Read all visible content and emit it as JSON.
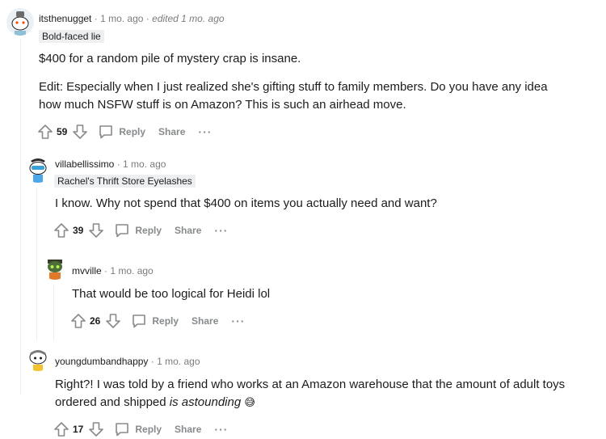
{
  "comments": [
    {
      "username": "itsthenugget",
      "sep": "·",
      "time": "1 mo. ago",
      "edited": "edited 1 mo. ago",
      "flair": "Bold-faced lie",
      "paragraphs": [
        "$400 for a random pile of mystery crap is insane.",
        "Edit: Especially when I just realized she's gifting stuff to family members. Do you have any idea how much NSFW stuff is on Amazon? This is such an airhead move."
      ],
      "score": "59",
      "reply": "Reply",
      "share": "Share",
      "more": "···"
    },
    {
      "username": "villabellissimo",
      "sep": "·",
      "time": "1 mo. ago",
      "flair": "Rachel's Thrift Store Eyelashes",
      "text": "I know. Why not spend that $400 on items you actually need and want?",
      "score": "39",
      "reply": "Reply",
      "share": "Share",
      "more": "···"
    },
    {
      "username": "mvville",
      "sep": "·",
      "time": "1 mo. ago",
      "text": "That would be too logical for Heidi lol",
      "score": "26",
      "reply": "Reply",
      "share": "Share",
      "more": "···"
    },
    {
      "username": "youngdumbandhappy",
      "sep": "·",
      "time": "1 mo. ago",
      "text_start": "Right?! I was told by a friend who works at an Amazon warehouse that the amount of adult toys ordered and shipped ",
      "text_italic": "is astounding",
      "emoji": "😅",
      "score": "17",
      "reply": "Reply",
      "share": "Share",
      "more": "···"
    }
  ],
  "colors": {
    "text": "#1c1c1c",
    "meta": "#7c7c7c",
    "action": "#878a8c",
    "flair_bg": "#edeff1",
    "thread_line": "#edeff1"
  }
}
